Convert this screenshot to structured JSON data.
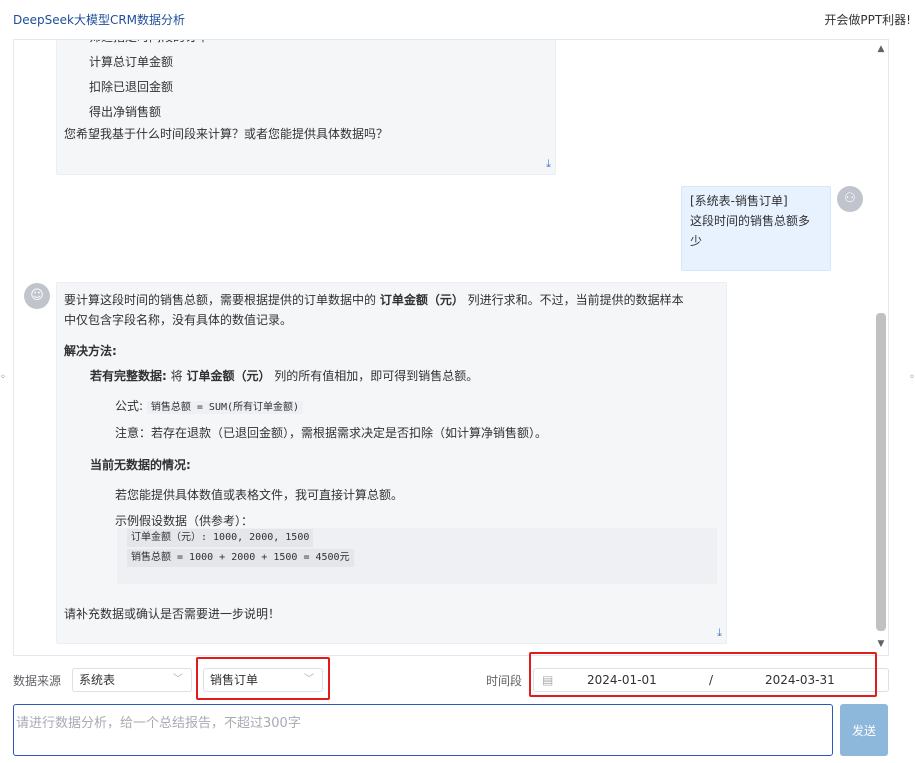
{
  "header": {
    "title": "DeepSeek大模型CRM数据分析",
    "right_text": "开会做PPT利器!"
  },
  "chat": {
    "assistant_msg_1": {
      "lines": [
        "筛选指定时间段的订单",
        "计算总订单金额",
        "扣除已退回金额",
        "得出净销售额"
      ],
      "question": "您希望我基于什么时间段来计算？或者您能提供具体数据吗？"
    },
    "user_msg": {
      "line1": "[系统表-销售订单]",
      "line2": "这段时间的销售总额多",
      "line3": "少"
    },
    "assistant_msg_2": {
      "intro_a": "要计算这段时间的销售总额，需要根据提供的订单数据中的 ",
      "intro_bold": "订单金额（元）",
      "intro_b": " 列进行求和。不过，当前提供的数据样本",
      "intro_line2": "中仅包含字段名称，没有具体的数值记录。",
      "solution_heading": "解决方法:",
      "complete_bold": "若有完整数据:",
      "complete_a": " 将 ",
      "complete_col": "订单金额（元）",
      "complete_b": " 列的所有值相加，即可得到销售总额。",
      "formula_label": "公式:",
      "formula_code": "销售总额 = SUM(所有订单金额)",
      "note": "注意：若存在退款（已退回金额），需根据需求决定是否扣除（如计算净销售额）。",
      "nodata_heading": "当前无数据的情况:",
      "nodata_line1": "若您能提供具体数值或表格文件，我可直接计算总额。",
      "nodata_line2": "示例假设数据（供参考）：",
      "code_line1": "订单金额（元）: 1000, 2000, 1500",
      "code_line2": "销售总额 = 1000 + 2000 + 1500 = 4500元",
      "closing": "请补充数据或确认是否需要进一步说明！"
    }
  },
  "filters": {
    "source_label": "数据来源",
    "source_value": "系统表",
    "table_value": "销售订单",
    "period_label": "时间段",
    "date_start": "2024-01-01",
    "date_sep": "/",
    "date_end": "2024-03-31"
  },
  "input": {
    "placeholder": "请进行数据分析，给一个总结报告，不超过300字",
    "send_label": "发送"
  },
  "colors": {
    "accent": "#2a57b8",
    "highlight": "#e21c1c",
    "send_button": "#8eb7dc",
    "user_bubble": "#e8f2ff",
    "assistant_bubble": "#f5f6f8"
  }
}
